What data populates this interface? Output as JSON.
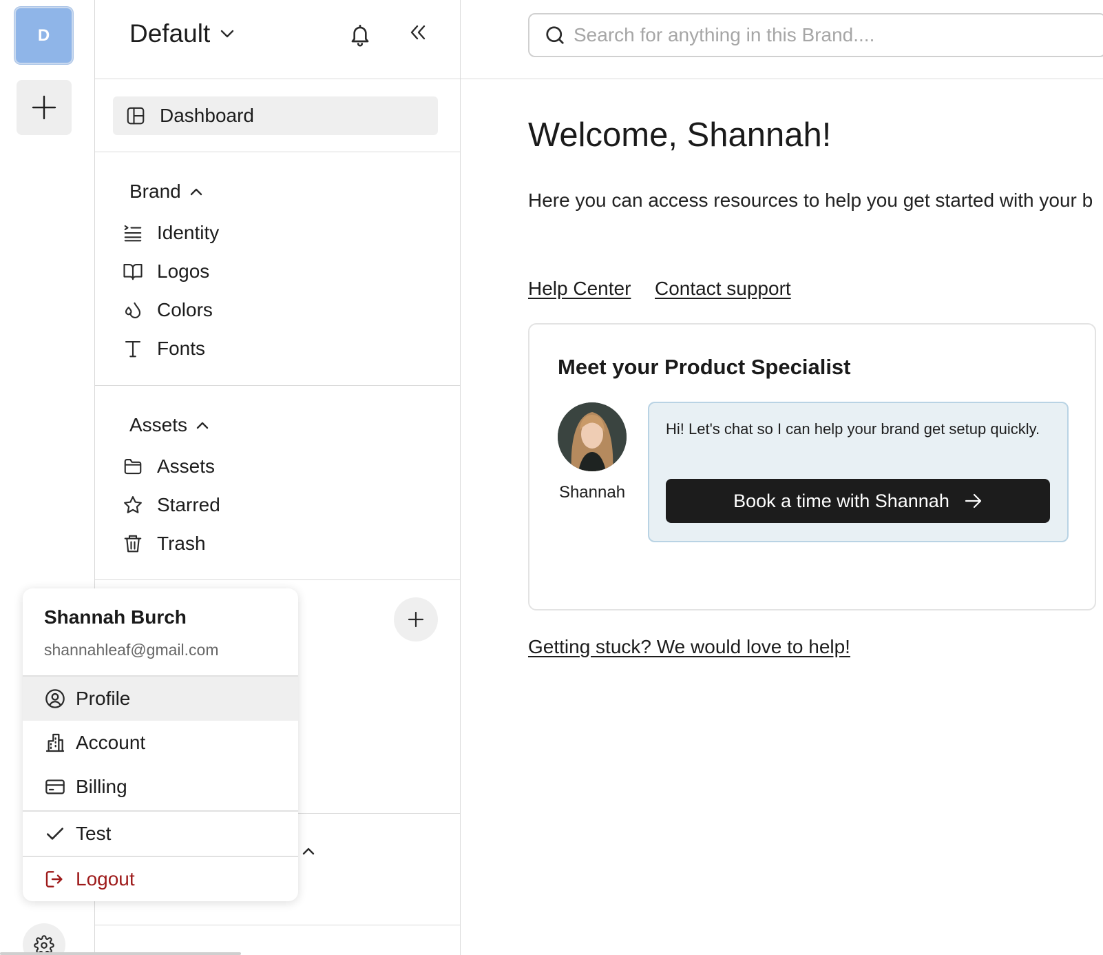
{
  "rail": {
    "brand_initial": "D"
  },
  "sidebar": {
    "workspace_name": "Default",
    "dashboard_label": "Dashboard",
    "brand_section": {
      "title": "Brand",
      "items": [
        {
          "label": "Identity",
          "icon": "identity-list-icon"
        },
        {
          "label": "Logos",
          "icon": "book-open-icon"
        },
        {
          "label": "Colors",
          "icon": "droplets-icon"
        },
        {
          "label": "Fonts",
          "icon": "type-icon"
        }
      ]
    },
    "assets_section": {
      "title": "Assets",
      "items": [
        {
          "label": "Assets",
          "icon": "folder-icon"
        },
        {
          "label": "Starred",
          "icon": "star-icon"
        },
        {
          "label": "Trash",
          "icon": "trash-icon"
        }
      ]
    }
  },
  "search": {
    "placeholder": "Search for anything in this Brand...."
  },
  "main": {
    "welcome": "Welcome, Shannah!",
    "intro": "Here you can access resources to help you get started with your b",
    "help_center": "Help Center",
    "contact_support": "Contact support",
    "specialist": {
      "title": "Meet your Product Specialist",
      "name": "Shannah",
      "message": "Hi! Let's chat so I can help your brand get setup quickly.",
      "button": "Book a time with Shannah"
    },
    "stuck_link": "Getting stuck? We would love to help!"
  },
  "user_menu": {
    "name": "Shannah Burch",
    "email": "shannahleaf@gmail.com",
    "items": [
      {
        "label": "Profile",
        "icon": "user-circle-icon"
      },
      {
        "label": "Account",
        "icon": "building-icon"
      },
      {
        "label": "Billing",
        "icon": "credit-card-icon"
      },
      {
        "label": "Test",
        "icon": "check-icon"
      },
      {
        "label": "Logout",
        "icon": "logout-icon"
      }
    ]
  },
  "colors": {
    "brand_avatar": "#8fb5e8",
    "primary_button": "#1c1c1c",
    "chat_bg": "#e8f0f4",
    "logout": "#9e1b1b"
  }
}
